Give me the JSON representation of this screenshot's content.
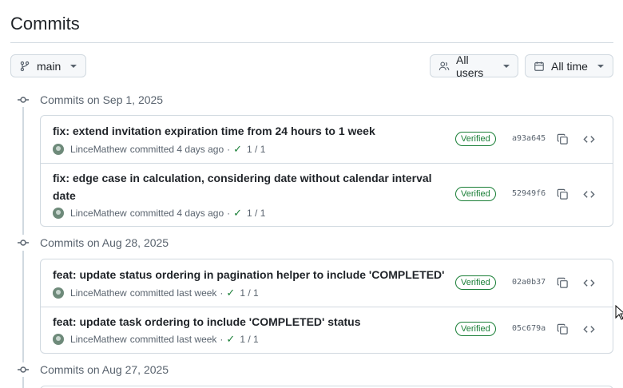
{
  "page": {
    "title": "Commits"
  },
  "toolbar": {
    "branch_label": "main",
    "users_label": "All users",
    "time_label": "All time"
  },
  "groups": [
    {
      "label": "Commits on Sep 1, 2025",
      "commits": [
        {
          "message": "fix: extend invitation expiration time from 24 hours to 1 week",
          "author": "LinceMathew",
          "when": "committed 4 days ago",
          "checks": "1 / 1",
          "badge": "Verified",
          "sha": "a93a645"
        },
        {
          "message": "fix: edge case in calculation, considering date without calendar interval date",
          "author": "LinceMathew",
          "when": "committed 4 days ago",
          "checks": "1 / 1",
          "badge": "Verified",
          "sha": "52949f6"
        }
      ]
    },
    {
      "label": "Commits on Aug 28, 2025",
      "commits": [
        {
          "message": "feat: update status ordering in pagination helper to include 'COMPLETED'",
          "author": "LinceMathew",
          "when": "committed last week",
          "checks": "1 / 1",
          "badge": "Verified",
          "sha": "02a0b37"
        },
        {
          "message": "feat: update task ordering to include 'COMPLETED' status",
          "author": "LinceMathew",
          "when": "committed last week",
          "checks": "1 / 1",
          "badge": "Verified",
          "sha": "05c679a"
        }
      ]
    },
    {
      "label": "Commits on Aug 27, 2025",
      "commits": []
    }
  ],
  "colors": {
    "verified": "#1a7f37",
    "border": "#d1d9e0",
    "muted": "#59636e"
  }
}
